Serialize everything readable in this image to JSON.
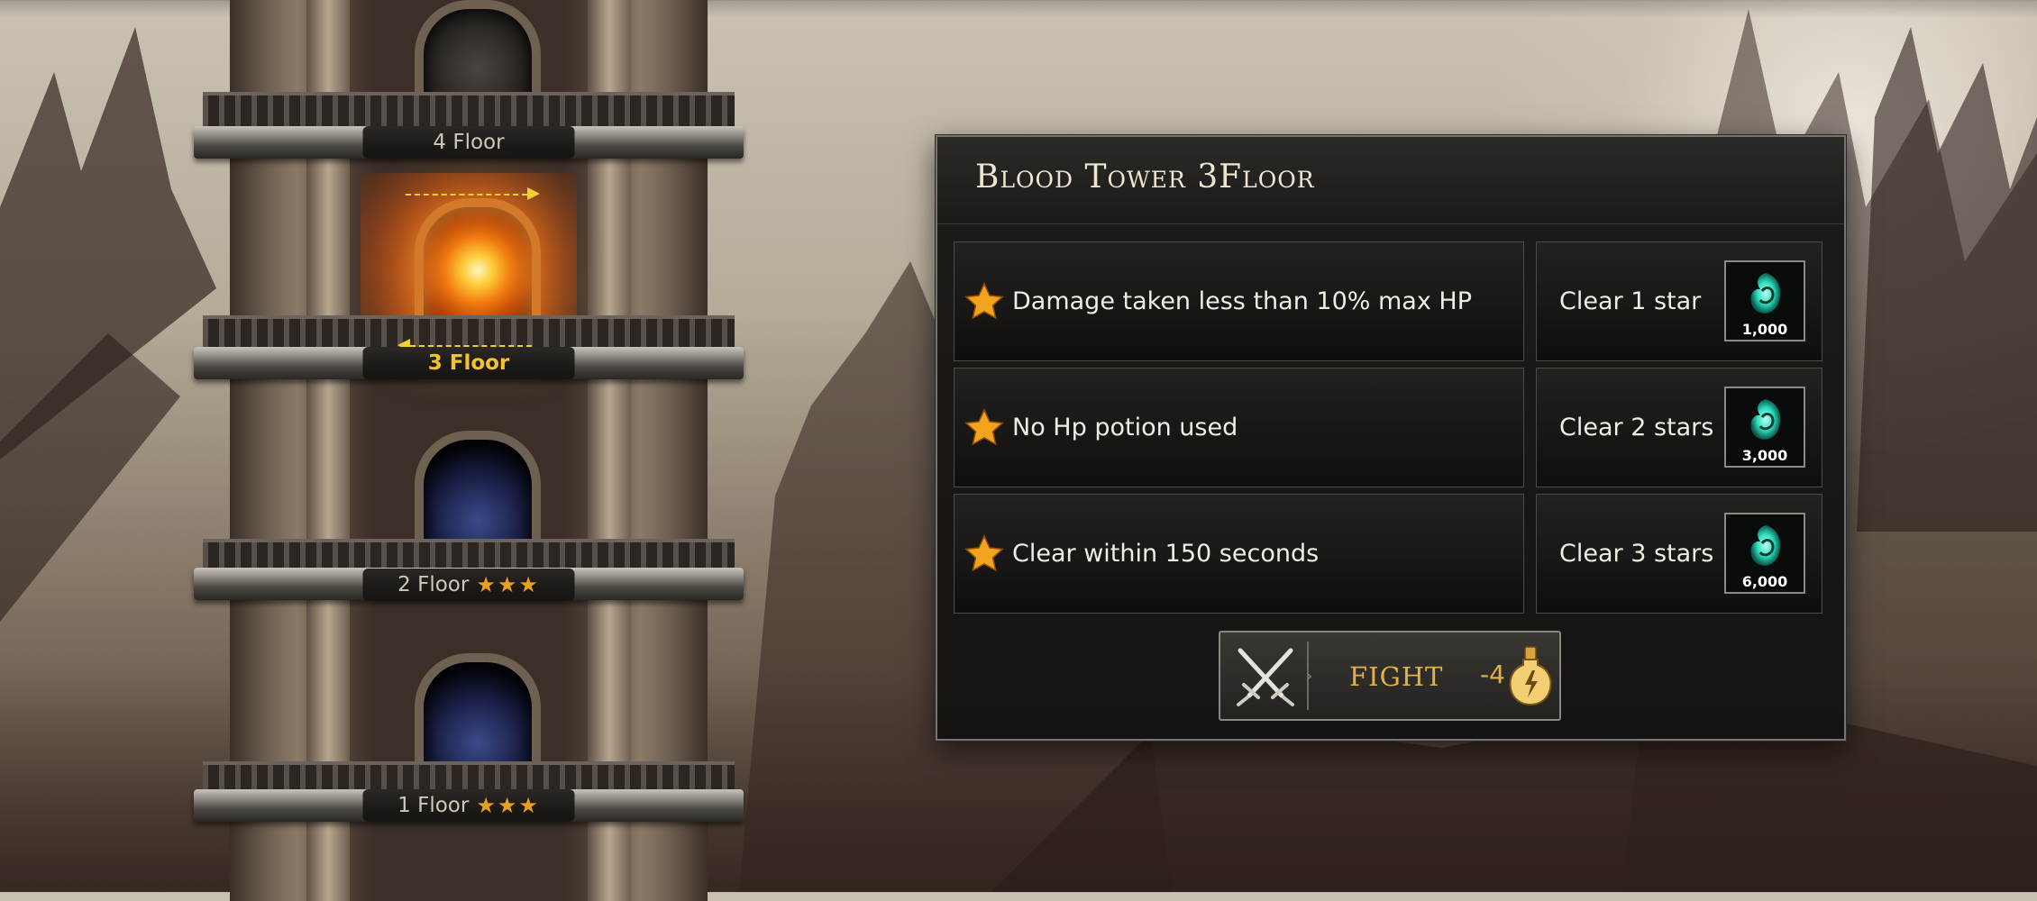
{
  "panel": {
    "title": "Blood Tower 3Floor"
  },
  "conditions": [
    {
      "text": "Damage taken less than 10% max HP",
      "reward_label": "Clear 1 star",
      "reward_amount": "1,000",
      "reward_icon": "soul-crystal-icon"
    },
    {
      "text": "No Hp potion used",
      "reward_label": "Clear 2 stars",
      "reward_amount": "3,000",
      "reward_icon": "soul-crystal-icon"
    },
    {
      "text": "Clear within 150 seconds",
      "reward_label": "Clear 3 stars",
      "reward_amount": "6,000",
      "reward_icon": "soul-crystal-icon"
    }
  ],
  "fight": {
    "label": "FIGHT",
    "cost": "-4",
    "cost_icon": "stamina-potion-icon"
  },
  "tower": {
    "floors": [
      {
        "label": "4 Floor",
        "stars": "",
        "state": "locked"
      },
      {
        "label": "3 Floor",
        "stars": "",
        "state": "current"
      },
      {
        "label": "2 Floor",
        "stars": "★★★",
        "state": "cleared"
      },
      {
        "label": "1 Floor",
        "stars": "★★★",
        "state": "cleared"
      }
    ]
  },
  "colors": {
    "accent_gold": "#e2b24a",
    "current_floor": "#f2c230",
    "star": "#e8a020",
    "crystal": "#2fe0c0"
  }
}
